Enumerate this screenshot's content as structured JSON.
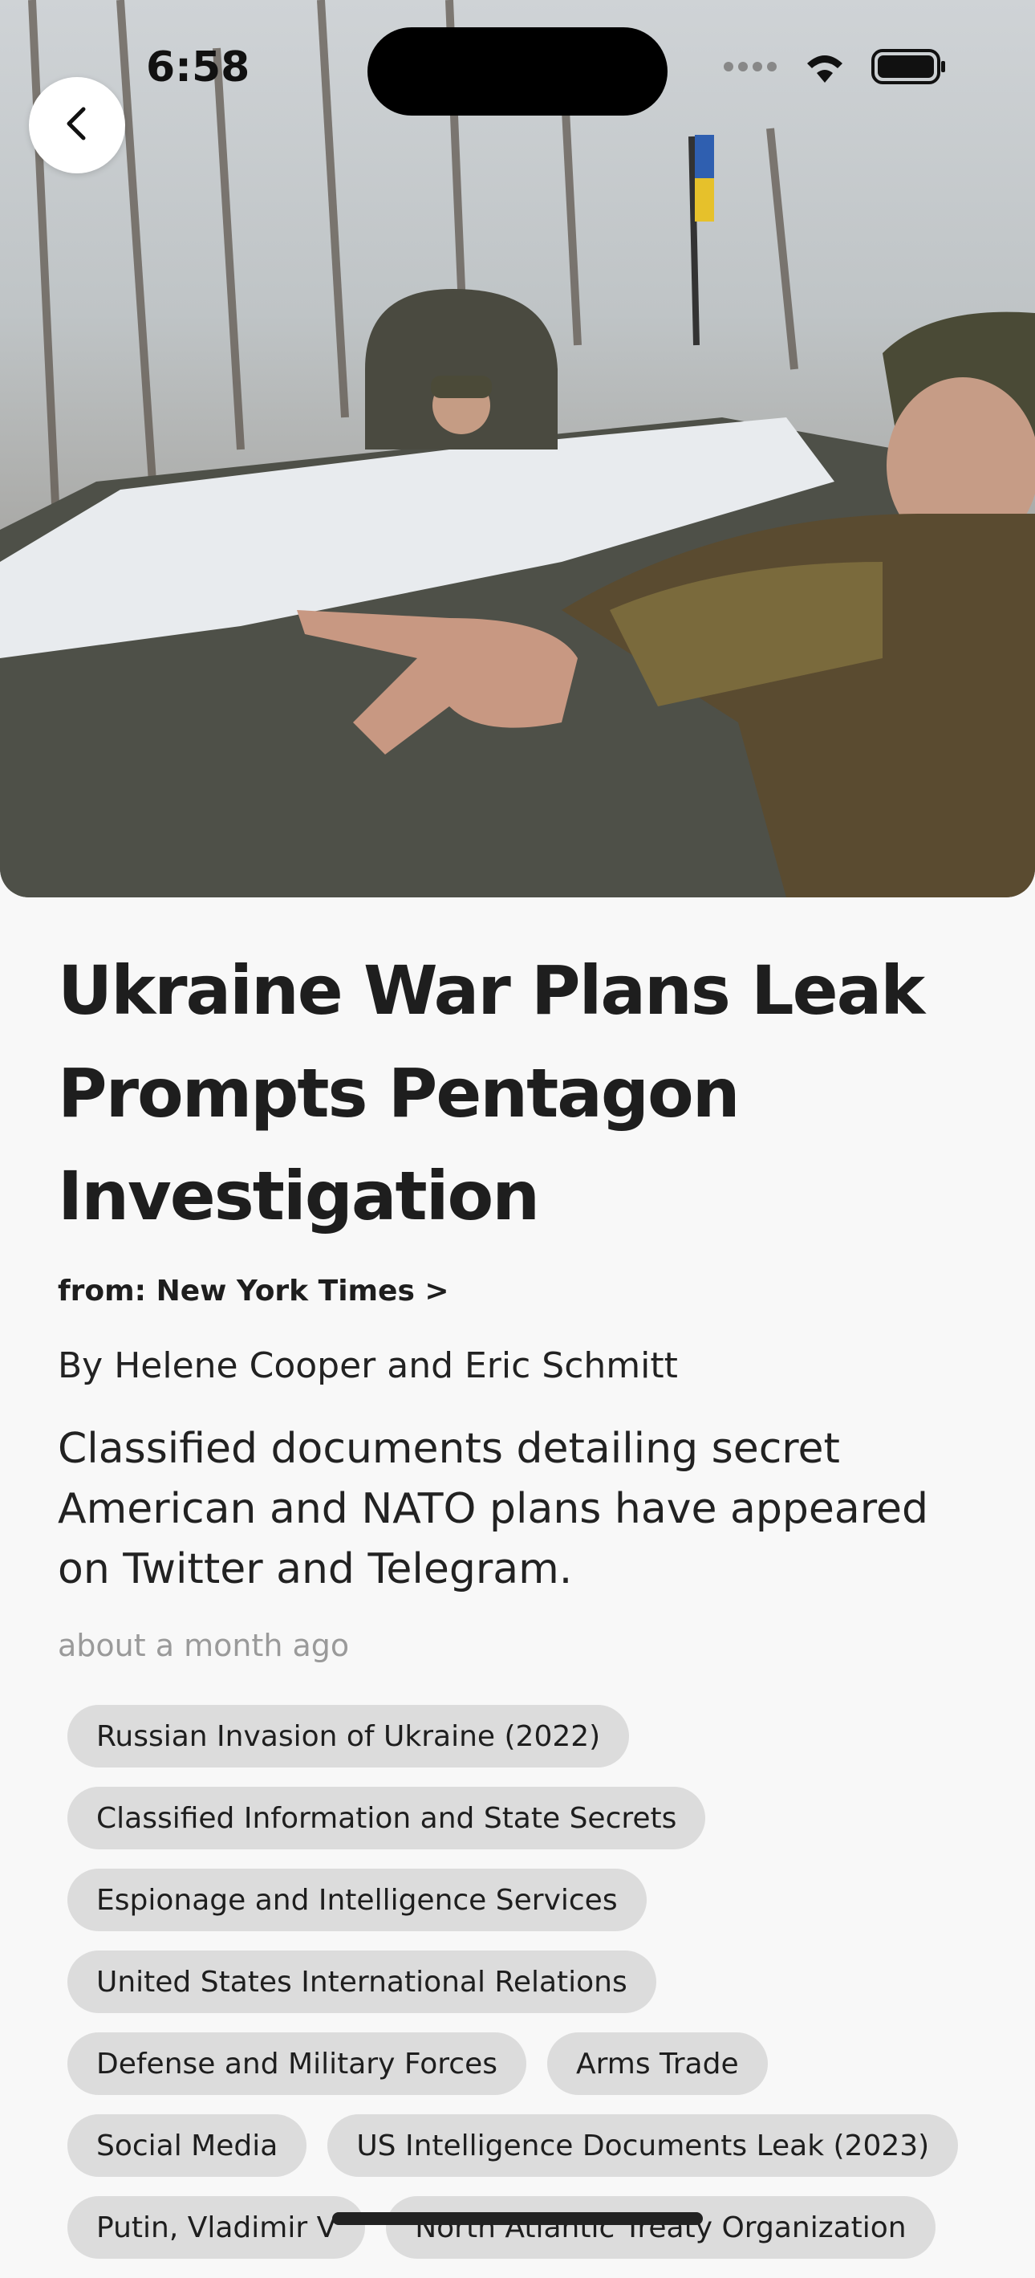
{
  "status_bar": {
    "time": "6:58",
    "icons": [
      "signal-icon",
      "wifi-icon",
      "battery-icon"
    ]
  },
  "hero": {
    "image_description": "photo-hero-image",
    "back_icon": "chevron-left-icon"
  },
  "article": {
    "title": "Ukraine War Plans Leak Prompts Pentagon Investigation",
    "source": "from: New York Times >",
    "byline": "By Helene Cooper and Eric Schmitt",
    "summary": "Classified documents detailing secret American and NATO plans have appeared on Twitter and Telegram.",
    "time_ago": "about a month ago"
  },
  "tags": [
    "Russian Invasion of Ukraine (2022)",
    "Classified Information and State Secrets",
    "Espionage and Intelligence Services",
    "United States International Relations",
    "Defense and Military Forces",
    "Arms Trade",
    "Social Media",
    "US Intelligence Documents Leak (2023)",
    "Putin, Vladimir V",
    "North Atlantic Treaty Organization"
  ],
  "colors": {
    "background": "#f8f8f8",
    "tag_background": "#dcdcdc",
    "text": "#1e1e1e",
    "muted": "#9a9a9a"
  }
}
